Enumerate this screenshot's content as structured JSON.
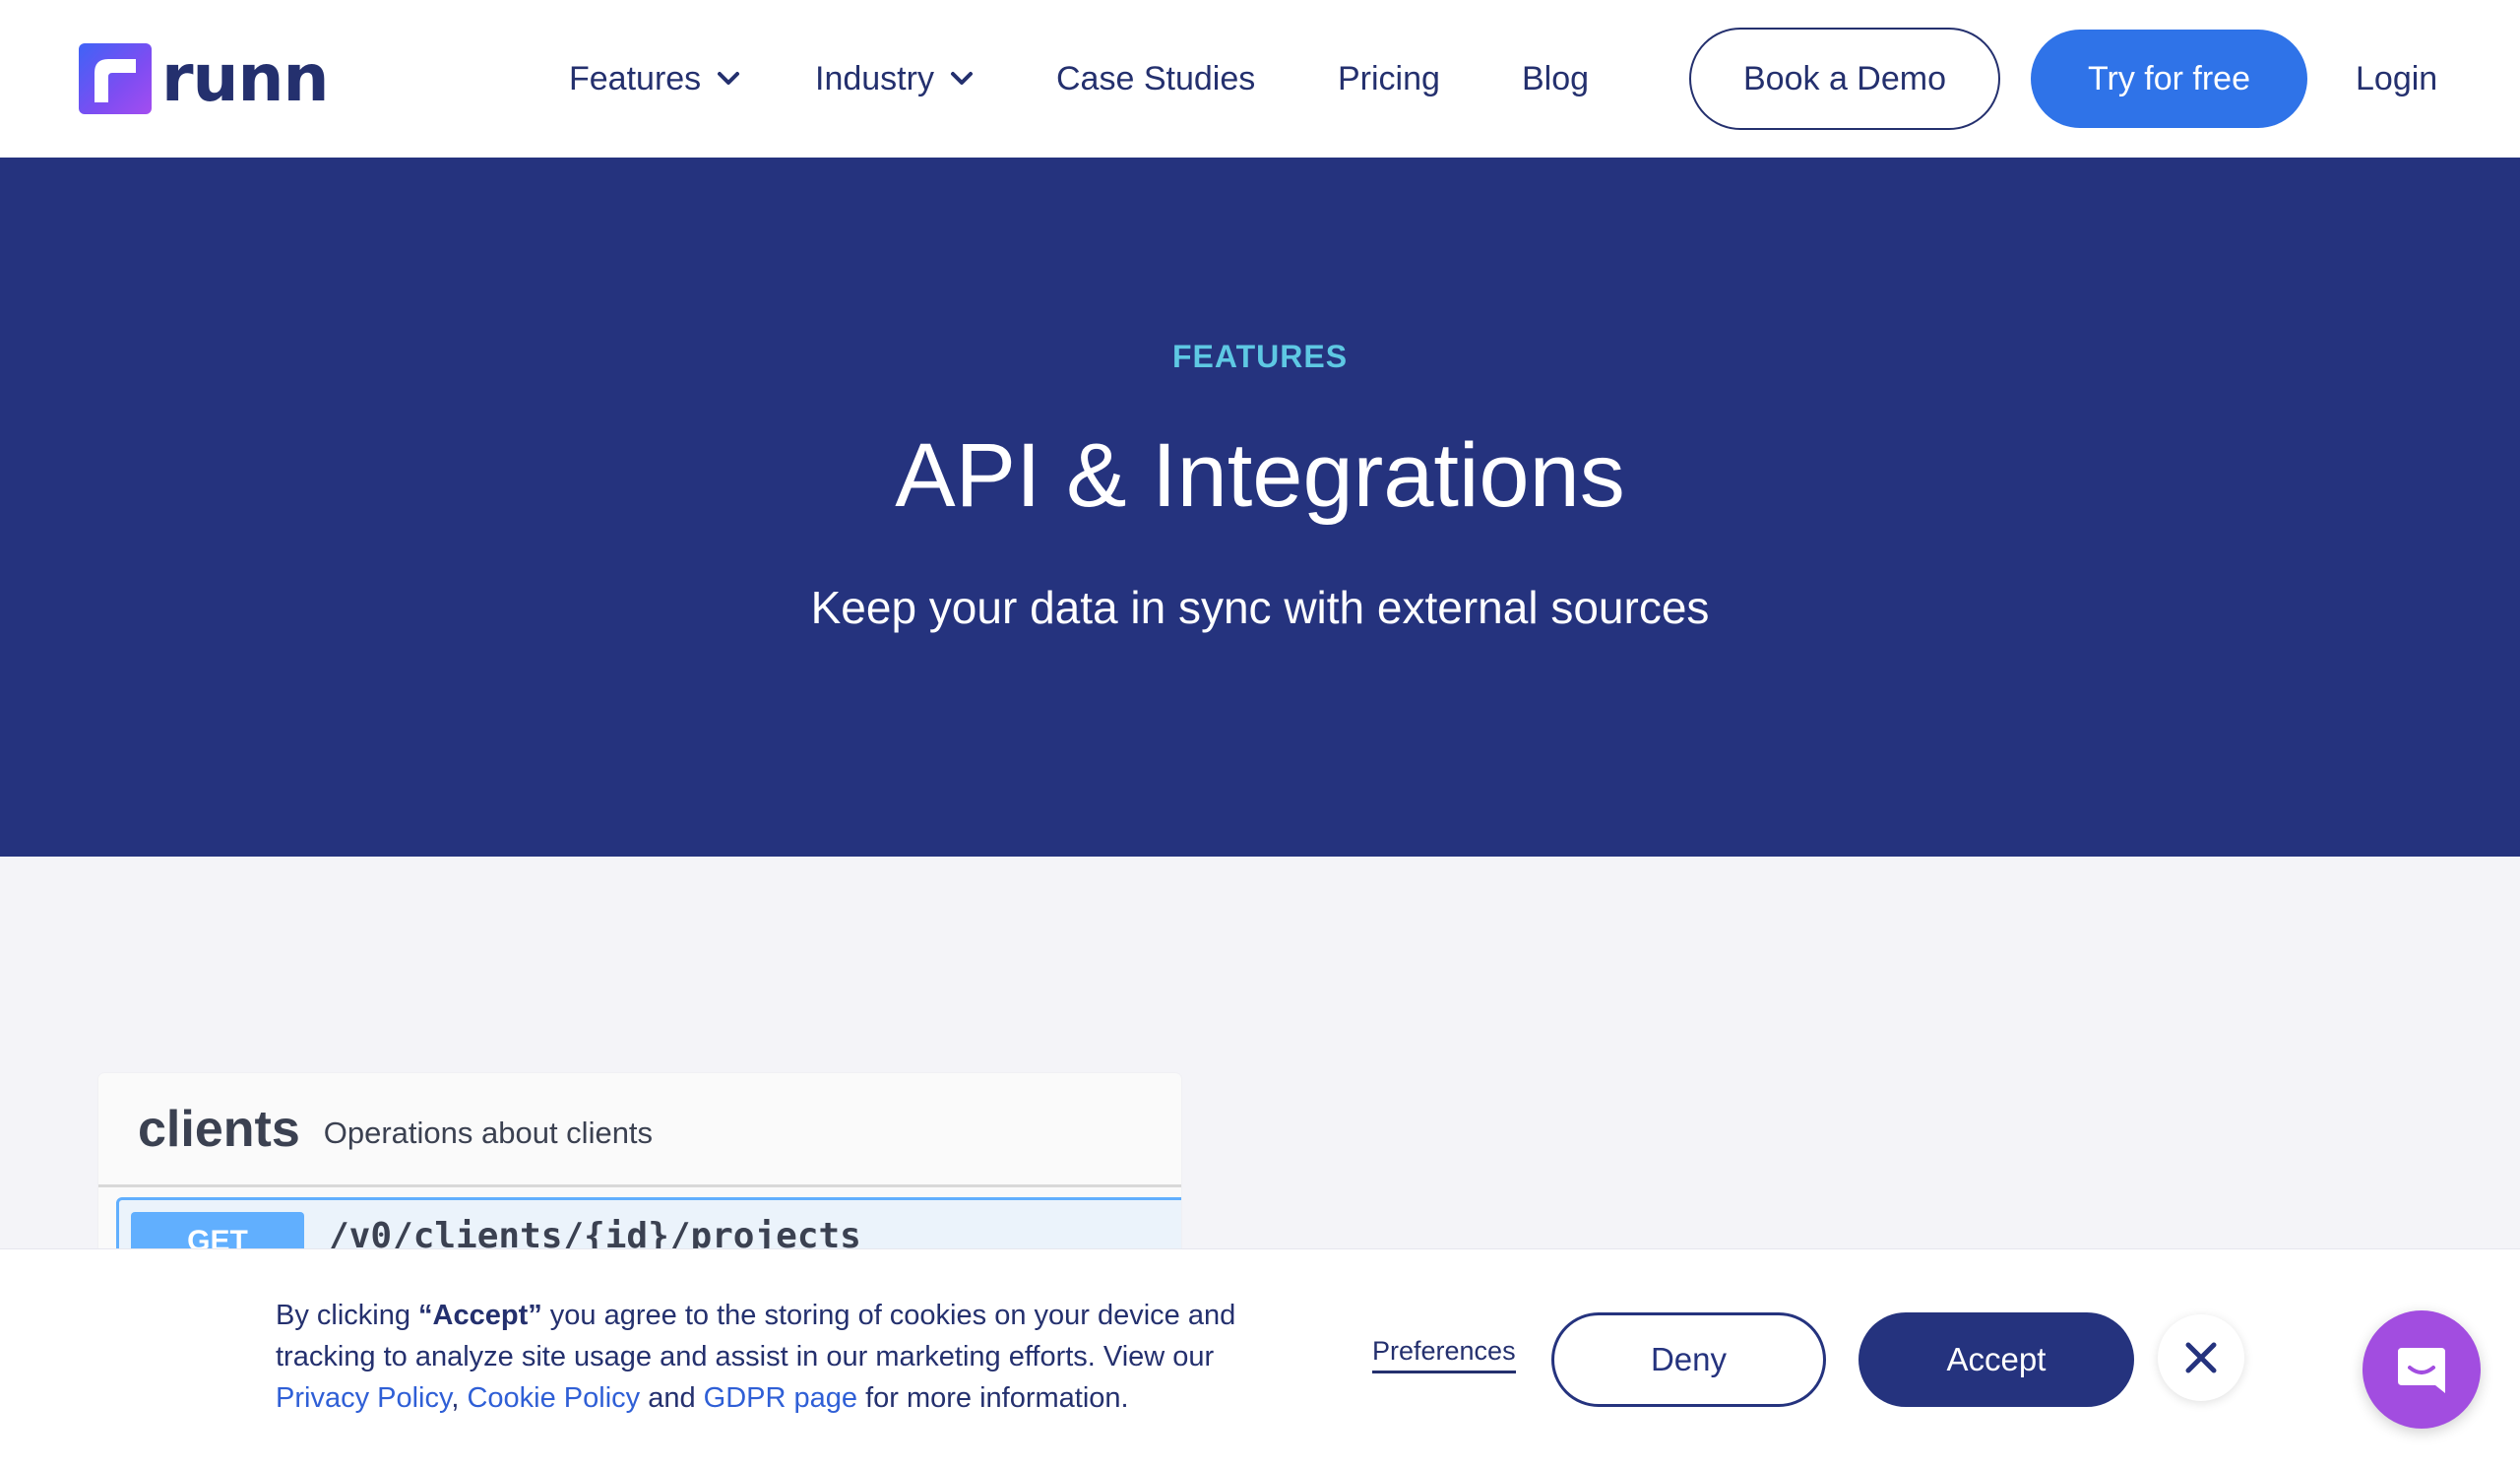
{
  "brand": {
    "name": "runn",
    "logo_colors": [
      "#3f63f6",
      "#a44df0"
    ]
  },
  "nav": {
    "items": [
      {
        "label": "Features",
        "has_dropdown": true
      },
      {
        "label": "Industry",
        "has_dropdown": true
      },
      {
        "label": "Case Studies",
        "has_dropdown": false
      },
      {
        "label": "Pricing",
        "has_dropdown": false
      },
      {
        "label": "Blog",
        "has_dropdown": false
      }
    ],
    "book_demo_label": "Book a Demo",
    "try_free_label": "Try for free",
    "login_label": "Login"
  },
  "hero": {
    "eyebrow": "FEATURES",
    "title": "API & Integrations",
    "subtitle": "Keep your data in sync with external sources",
    "background_color": "#25337e"
  },
  "api_preview": {
    "tag": "clients",
    "tag_description": "Operations about clients",
    "operation": {
      "method": "GET",
      "path": "/v0/clients/{id}/projects"
    }
  },
  "cookie_banner": {
    "text_before": "By clicking ",
    "accept_quote": "“Accept”",
    "text_middle": " you agree to the storing of cookies on your device and tracking to analyze site usage and assist in our marketing efforts. View our ",
    "privacy_link": "Privacy Policy",
    "sep1": ", ",
    "cookie_link": "Cookie Policy",
    "sep2": " and ",
    "gdpr_link": "GDPR page",
    "text_after": " for more information.",
    "preferences_label": "Preferences",
    "deny_label": "Deny",
    "accept_label": "Accept",
    "close_icon": "close-icon"
  },
  "chat": {
    "icon": "chat-icon",
    "color": "#a24de0"
  },
  "colors": {
    "accent_blue": "#2f73e8",
    "navy": "#25337e",
    "eyebrow": "#5ec8e3"
  }
}
